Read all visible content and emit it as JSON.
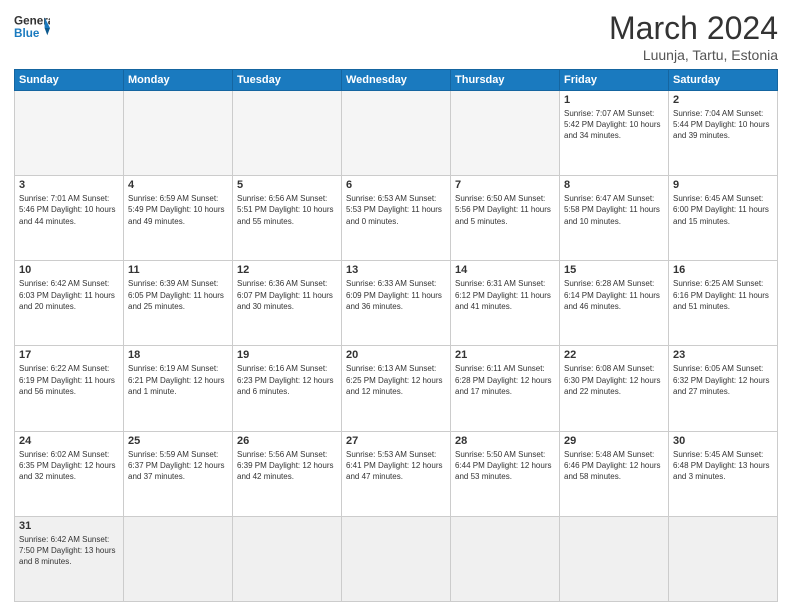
{
  "header": {
    "logo_general": "General",
    "logo_blue": "Blue",
    "month_year": "March 2024",
    "location": "Luunja, Tartu, Estonia"
  },
  "weekdays": [
    "Sunday",
    "Monday",
    "Tuesday",
    "Wednesday",
    "Thursday",
    "Friday",
    "Saturday"
  ],
  "weeks": [
    [
      {
        "day": "",
        "info": ""
      },
      {
        "day": "",
        "info": ""
      },
      {
        "day": "",
        "info": ""
      },
      {
        "day": "",
        "info": ""
      },
      {
        "day": "",
        "info": ""
      },
      {
        "day": "1",
        "info": "Sunrise: 7:07 AM\nSunset: 5:42 PM\nDaylight: 10 hours\nand 34 minutes."
      },
      {
        "day": "2",
        "info": "Sunrise: 7:04 AM\nSunset: 5:44 PM\nDaylight: 10 hours\nand 39 minutes."
      }
    ],
    [
      {
        "day": "3",
        "info": "Sunrise: 7:01 AM\nSunset: 5:46 PM\nDaylight: 10 hours\nand 44 minutes."
      },
      {
        "day": "4",
        "info": "Sunrise: 6:59 AM\nSunset: 5:49 PM\nDaylight: 10 hours\nand 49 minutes."
      },
      {
        "day": "5",
        "info": "Sunrise: 6:56 AM\nSunset: 5:51 PM\nDaylight: 10 hours\nand 55 minutes."
      },
      {
        "day": "6",
        "info": "Sunrise: 6:53 AM\nSunset: 5:53 PM\nDaylight: 11 hours\nand 0 minutes."
      },
      {
        "day": "7",
        "info": "Sunrise: 6:50 AM\nSunset: 5:56 PM\nDaylight: 11 hours\nand 5 minutes."
      },
      {
        "day": "8",
        "info": "Sunrise: 6:47 AM\nSunset: 5:58 PM\nDaylight: 11 hours\nand 10 minutes."
      },
      {
        "day": "9",
        "info": "Sunrise: 6:45 AM\nSunset: 6:00 PM\nDaylight: 11 hours\nand 15 minutes."
      }
    ],
    [
      {
        "day": "10",
        "info": "Sunrise: 6:42 AM\nSunset: 6:03 PM\nDaylight: 11 hours\nand 20 minutes."
      },
      {
        "day": "11",
        "info": "Sunrise: 6:39 AM\nSunset: 6:05 PM\nDaylight: 11 hours\nand 25 minutes."
      },
      {
        "day": "12",
        "info": "Sunrise: 6:36 AM\nSunset: 6:07 PM\nDaylight: 11 hours\nand 30 minutes."
      },
      {
        "day": "13",
        "info": "Sunrise: 6:33 AM\nSunset: 6:09 PM\nDaylight: 11 hours\nand 36 minutes."
      },
      {
        "day": "14",
        "info": "Sunrise: 6:31 AM\nSunset: 6:12 PM\nDaylight: 11 hours\nand 41 minutes."
      },
      {
        "day": "15",
        "info": "Sunrise: 6:28 AM\nSunset: 6:14 PM\nDaylight: 11 hours\nand 46 minutes."
      },
      {
        "day": "16",
        "info": "Sunrise: 6:25 AM\nSunset: 6:16 PM\nDaylight: 11 hours\nand 51 minutes."
      }
    ],
    [
      {
        "day": "17",
        "info": "Sunrise: 6:22 AM\nSunset: 6:19 PM\nDaylight: 11 hours\nand 56 minutes."
      },
      {
        "day": "18",
        "info": "Sunrise: 6:19 AM\nSunset: 6:21 PM\nDaylight: 12 hours\nand 1 minute."
      },
      {
        "day": "19",
        "info": "Sunrise: 6:16 AM\nSunset: 6:23 PM\nDaylight: 12 hours\nand 6 minutes."
      },
      {
        "day": "20",
        "info": "Sunrise: 6:13 AM\nSunset: 6:25 PM\nDaylight: 12 hours\nand 12 minutes."
      },
      {
        "day": "21",
        "info": "Sunrise: 6:11 AM\nSunset: 6:28 PM\nDaylight: 12 hours\nand 17 minutes."
      },
      {
        "day": "22",
        "info": "Sunrise: 6:08 AM\nSunset: 6:30 PM\nDaylight: 12 hours\nand 22 minutes."
      },
      {
        "day": "23",
        "info": "Sunrise: 6:05 AM\nSunset: 6:32 PM\nDaylight: 12 hours\nand 27 minutes."
      }
    ],
    [
      {
        "day": "24",
        "info": "Sunrise: 6:02 AM\nSunset: 6:35 PM\nDaylight: 12 hours\nand 32 minutes."
      },
      {
        "day": "25",
        "info": "Sunrise: 5:59 AM\nSunset: 6:37 PM\nDaylight: 12 hours\nand 37 minutes."
      },
      {
        "day": "26",
        "info": "Sunrise: 5:56 AM\nSunset: 6:39 PM\nDaylight: 12 hours\nand 42 minutes."
      },
      {
        "day": "27",
        "info": "Sunrise: 5:53 AM\nSunset: 6:41 PM\nDaylight: 12 hours\nand 47 minutes."
      },
      {
        "day": "28",
        "info": "Sunrise: 5:50 AM\nSunset: 6:44 PM\nDaylight: 12 hours\nand 53 minutes."
      },
      {
        "day": "29",
        "info": "Sunrise: 5:48 AM\nSunset: 6:46 PM\nDaylight: 12 hours\nand 58 minutes."
      },
      {
        "day": "30",
        "info": "Sunrise: 5:45 AM\nSunset: 6:48 PM\nDaylight: 13 hours\nand 3 minutes."
      }
    ],
    [
      {
        "day": "31",
        "info": "Sunrise: 6:42 AM\nSunset: 7:50 PM\nDaylight: 13 hours\nand 8 minutes."
      },
      {
        "day": "",
        "info": ""
      },
      {
        "day": "",
        "info": ""
      },
      {
        "day": "",
        "info": ""
      },
      {
        "day": "",
        "info": ""
      },
      {
        "day": "",
        "info": ""
      },
      {
        "day": "",
        "info": ""
      }
    ]
  ]
}
